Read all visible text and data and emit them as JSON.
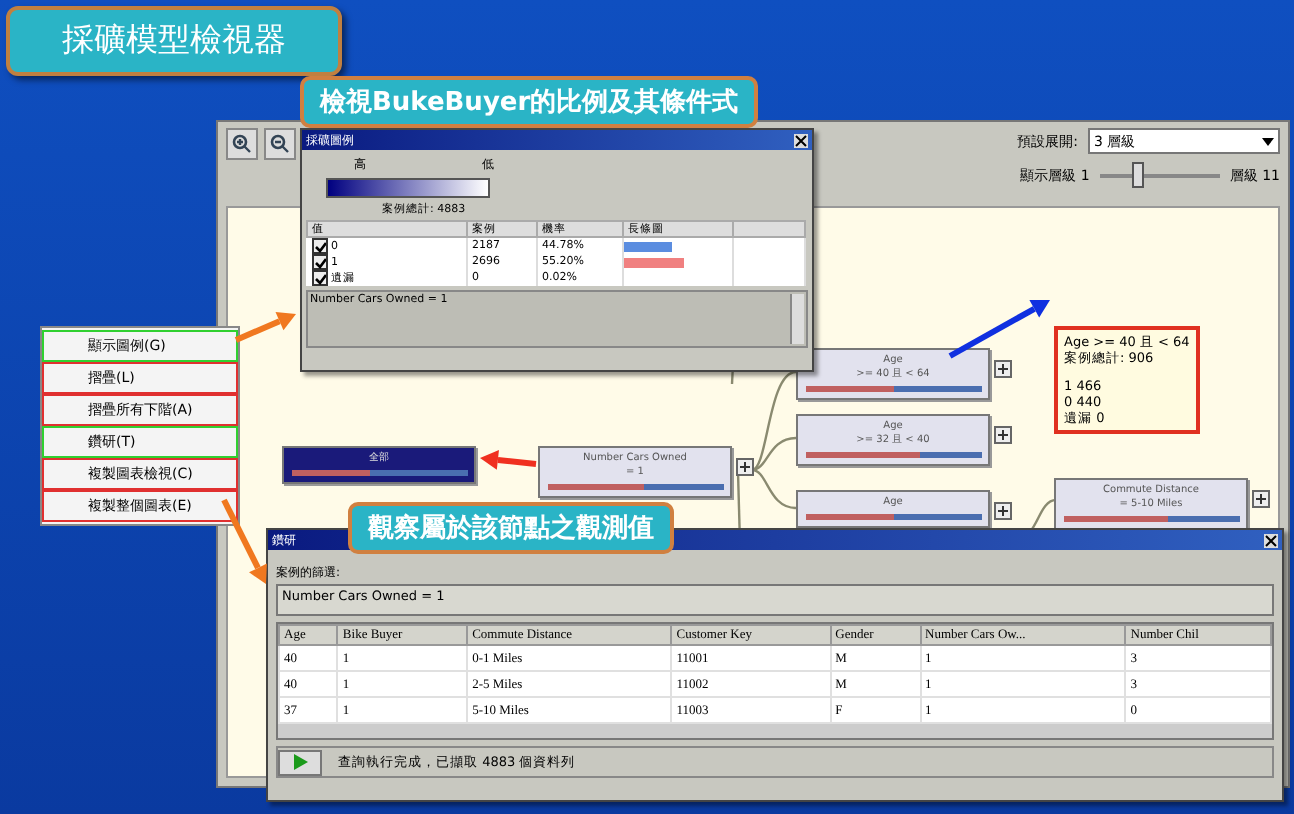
{
  "slide_title": "採礦模型檢視器",
  "callouts": [
    "檢視BukeBuyer的比例及其條件式",
    "觀察屬於該節點之觀測值"
  ],
  "toolbar": {
    "expand_label": "預設展開:",
    "expand_value": "3 層級",
    "level_from": "顯示層級 1",
    "level_to": "層級 11",
    "slider": {
      "level": 0.3
    }
  },
  "legend": {
    "title": "採礦圖例",
    "high": "高",
    "low": "低",
    "total": "案例總計: 4883",
    "columns": [
      "值",
      "案例",
      "機率",
      "長條圖"
    ],
    "rows": [
      {
        "value": "0",
        "cases": "2187",
        "prob": "44.78%",
        "level": 0.45,
        "color": "#5b8de0",
        "checked": true
      },
      {
        "value": "1",
        "cases": "2696",
        "prob": "55.20%",
        "level": 0.55,
        "color": "#f08080",
        "checked": true
      },
      {
        "value": "遺漏",
        "cases": "0",
        "prob": "0.02%",
        "checked": true
      }
    ],
    "condition": "Number Cars Owned = 1"
  },
  "tooltip": {
    "lines": [
      "Age >= 40 且 < 64",
      "案例總計: 906"
    ],
    "counts": [
      "1  466",
      "0  440",
      "遺漏  0"
    ]
  },
  "nodes": [
    {
      "title": "全部",
      "selected": true,
      "level": 0.45
    },
    {
      "title": "Number Cars Owned",
      "detail": "= 1",
      "selected": false,
      "level": 0.55
    },
    {
      "title": "Age",
      "detail": ">= 40 且 < 64",
      "selected": false,
      "level": 0.5
    },
    {
      "title": "Age",
      "detail": ">= 32 且 < 40",
      "selected": false,
      "level": 0.65
    },
    {
      "title": "Age",
      "selected": false,
      "level": 0.5
    },
    {
      "title": "Commute Distance",
      "detail": "= 5-10 Miles",
      "selected": false,
      "level": 0.6
    }
  ],
  "context_menu": [
    {
      "label": "顯示圖例(G)",
      "highlighted": true
    },
    {
      "label": "摺疊(L)",
      "highlighted": false
    },
    {
      "label": "摺疊所有下階(A)",
      "highlighted": false
    },
    {
      "label": "鑽研(T)",
      "highlighted": true
    },
    {
      "label": "複製圖表檢視(C)",
      "highlighted": false
    },
    {
      "label": "複製整個圖表(E)",
      "highlighted": false
    }
  ],
  "arrows": [
    {
      "color": "#f07820"
    },
    {
      "color": "#1030e0"
    },
    {
      "color": "#f03020"
    },
    {
      "color": "#f07820"
    }
  ],
  "drillthrough": {
    "title": "鑽研",
    "filter_label": "案例的篩選:",
    "filter": "Number Cars Owned = 1",
    "columns": [
      "Age",
      "Bike Buyer",
      "Commute Distance",
      "Customer Key",
      "Gender",
      "Number Cars Ow...",
      "Number Chil"
    ],
    "rows": [
      [
        "40",
        "1",
        "0-1 Miles",
        "11001",
        "M",
        "1",
        "3"
      ],
      [
        "40",
        "1",
        "2-5 Miles",
        "11002",
        "M",
        "1",
        "3"
      ],
      [
        "37",
        "1",
        "5-10 Miles",
        "11003",
        "F",
        "1",
        "0"
      ]
    ],
    "status": "查詢執行完成，已擷取 4883 個資料列"
  }
}
